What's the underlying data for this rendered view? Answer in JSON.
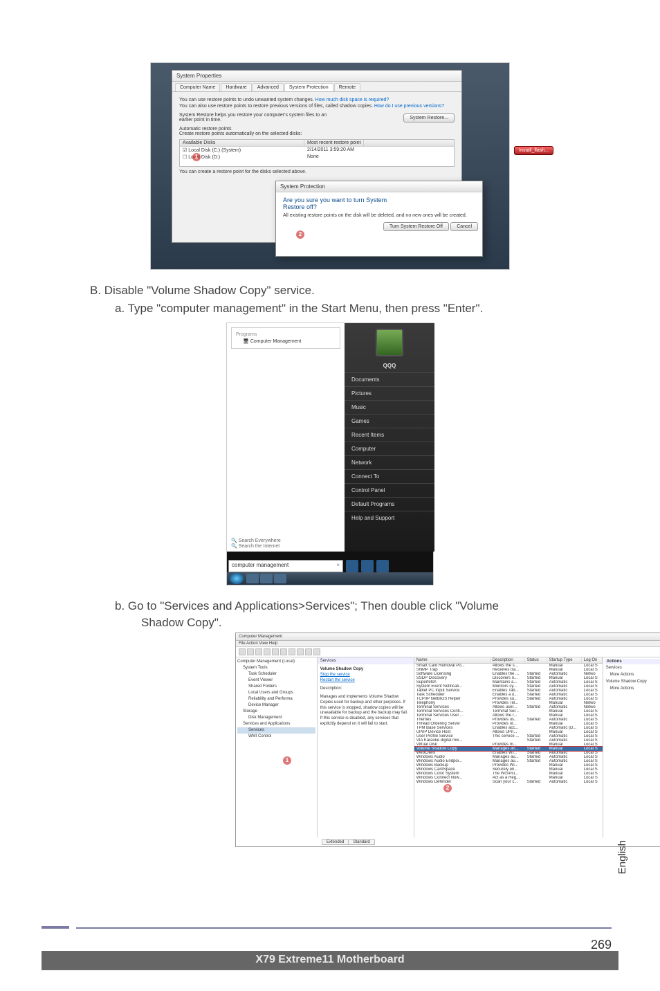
{
  "fig1": {
    "window_title": "System Properties",
    "tabs": [
      "Computer Name",
      "Hardware",
      "Advanced",
      "System Protection",
      "Remote"
    ],
    "info1": "You can use restore points to undo unwanted system changes.",
    "info1_link": "How much disk space is required?",
    "info2": "You can also use restore points to restore previous versions of files, called shadow copies.",
    "info2_link": "How do I use previous versions?",
    "restore_help": "System Restore helps you restore your computer's system files to an earlier point in time.",
    "restore_btn": "System Restore...",
    "auto_heading": "Automatic restore points",
    "auto_text": "Create restore points automatically on the selected disks:",
    "col_disk": "Available Disks",
    "col_recent": "Most recent restore point",
    "row1_disk": "Local Disk (C:) (System)",
    "row1_recent": "2/14/2011 3:59:20 AM",
    "row2_disk": "Local Disk (D:)",
    "row2_recent": "None",
    "install_btn": "Install_flash...",
    "create_text": "You can create a restore point for the disks selected above.",
    "confirm_title": "System Protection",
    "confirm_q1": "Are you sure you want to turn System",
    "confirm_q2": "Restore off?",
    "confirm_body": "All existing restore points on the disk will be deleted, and no new ones will be created.",
    "confirm_ok": "Turn System Restore Off",
    "confirm_cancel": "Cancel",
    "mark1": "1",
    "mark2": "2"
  },
  "stepB": "B. Disable \"Volume Shadow Copy\" service.",
  "stepBa": "a. Type \"computer management\" in the Start Menu, then press \"Enter\".",
  "fig2": {
    "programs_label": "Programs",
    "program_item": "Computer Management",
    "search_everywhere": "Search Everywhere",
    "search_internet": "Search the Internet",
    "search_value": "computer management",
    "user": "QQQ",
    "right_items": [
      "Documents",
      "Pictures",
      "Music",
      "Games",
      "Recent Items",
      "Computer",
      "Network",
      "Connect To",
      "Control Panel",
      "Default Programs",
      "Help and Support"
    ]
  },
  "stepBb_pre": "b. Go to \"Services and Applications>Services\"; Then double click \"Volume",
  "stepBb_post": "Shadow Copy\".",
  "fig3": {
    "title": "Computer Management",
    "menu": "File   Action   View   Help",
    "root": "Computer Management (Local)",
    "tree": [
      "System Tools",
      "Task Scheduler",
      "Event Viewer",
      "Shared Folders",
      "Local Users and Groups",
      "Reliability and Performa",
      "Device Manager",
      "Storage",
      "Disk Management",
      "Services and Applications",
      "Services",
      "WMI Control"
    ],
    "panel_header": "Services",
    "svc_name": "Volume Shadow Copy",
    "svc_stop": "Stop the service",
    "svc_restart": "Restart the service",
    "svc_desc_label": "Description:",
    "svc_desc": "Manages and implements Volume Shadow Copies used for backup and other purposes. If this service is stopped, shadow copies will be unavailable for backup and the backup may fail. If this service is disabled, any services that explicitly depend on it will fail to start.",
    "cols": [
      "Name",
      "Description",
      "Status",
      "Startup Type",
      "Log On"
    ],
    "rows": [
      {
        "n": "Smart Card Removal Po...",
        "d": "Allows the s...",
        "s": "",
        "t": "Manual",
        "l": "Local S"
      },
      {
        "n": "SNMP Trap",
        "d": "Receives tra...",
        "s": "",
        "t": "Manual",
        "l": "Local S"
      },
      {
        "n": "Software Licensing",
        "d": "Enables the ...",
        "s": "Started",
        "t": "Automatic",
        "l": "Netwo"
      },
      {
        "n": "SSDP Discovery",
        "d": "Discovers n...",
        "s": "Started",
        "t": "Manual",
        "l": "Local S"
      },
      {
        "n": "Superfetch",
        "d": "Maintains a...",
        "s": "Started",
        "t": "Automatic",
        "l": "Local S"
      },
      {
        "n": "System Event Notificati...",
        "d": "Monitors sy...",
        "s": "Started",
        "t": "Automatic",
        "l": "Local S"
      },
      {
        "n": "Tablet PC Input Service",
        "d": "Enables Tab...",
        "s": "Started",
        "t": "Automatic",
        "l": "Local S"
      },
      {
        "n": "Task Scheduler",
        "d": "Enables a u...",
        "s": "Started",
        "t": "Automatic",
        "l": "Local S"
      },
      {
        "n": "TCP/IP NetBIOS Helper",
        "d": "Provides su...",
        "s": "Started",
        "t": "Automatic",
        "l": "Local S"
      },
      {
        "n": "Telephony",
        "d": "Provides Tel...",
        "s": "",
        "t": "Manual",
        "l": "Netwo"
      },
      {
        "n": "Terminal Services",
        "d": "Allows user...",
        "s": "Started",
        "t": "Automatic",
        "l": "Netwo"
      },
      {
        "n": "Terminal Services Confi...",
        "d": "Terminal Ser...",
        "s": "",
        "t": "Manual",
        "l": "Local S"
      },
      {
        "n": "Terminal Services User ...",
        "d": "Allows the r...",
        "s": "",
        "t": "Manual",
        "l": "Local S"
      },
      {
        "n": "Themes",
        "d": "Provides us...",
        "s": "Started",
        "t": "Automatic",
        "l": "Local S"
      },
      {
        "n": "Thread Ordering Server",
        "d": "Provides or...",
        "s": "",
        "t": "Manual",
        "l": "Local S"
      },
      {
        "n": "TPM Base Services",
        "d": "Enables acc...",
        "s": "",
        "t": "Automatic (D...",
        "l": "Local S"
      },
      {
        "n": "UPnP Device Host",
        "d": "Allows UPn...",
        "s": "",
        "t": "Manual",
        "l": "Local S"
      },
      {
        "n": "User Profile Service",
        "d": "This service ...",
        "s": "Started",
        "t": "Automatic",
        "l": "Local S"
      },
      {
        "n": "VIA Karaoke digital mix...",
        "d": "",
        "s": "Started",
        "t": "Automatic",
        "l": "Local S"
      },
      {
        "n": "Virtual Disk",
        "d": "Provides m...",
        "s": "",
        "t": "Manual",
        "l": "Local S"
      },
      {
        "n": "Volume Shadow Copy",
        "d": "Manages an...",
        "s": "Started",
        "t": "Manual",
        "l": "Local S",
        "hl": true
      },
      {
        "n": "WebClient",
        "d": "Enables Wi...",
        "s": "Started",
        "t": "Automatic",
        "l": "Local S"
      },
      {
        "n": "Windows Audio",
        "d": "Manages au...",
        "s": "Started",
        "t": "Automatic",
        "l": "Local S"
      },
      {
        "n": "Windows Audio Endpoi...",
        "d": "Manages au...",
        "s": "Started",
        "t": "Automatic",
        "l": "Local S"
      },
      {
        "n": "Windows Backup",
        "d": "Provides Wi...",
        "s": "",
        "t": "Manual",
        "l": "Local S"
      },
      {
        "n": "Windows CardSpace",
        "d": "Securely en...",
        "s": "",
        "t": "Manual",
        "l": "Local S"
      },
      {
        "n": "Windows Color System",
        "d": "The WcsPlu...",
        "s": "",
        "t": "Manual",
        "l": "Local S"
      },
      {
        "n": "Windows Connect Now...",
        "d": "Act as a Reg...",
        "s": "",
        "t": "Manual",
        "l": "Local S"
      },
      {
        "n": "Windows Defender",
        "d": "Scan your c...",
        "s": "Started",
        "t": "Automatic",
        "l": "Local S"
      }
    ],
    "actions_header": "Actions",
    "actions_svc": "Services",
    "actions_more1": "More Actions",
    "actions_vsc": "Volume Shadow Copy",
    "actions_more2": "More Actions",
    "tab_ext": "Extended",
    "tab_std": "Standard",
    "mark1": "1",
    "mark2": "2"
  },
  "side_label": "English",
  "page_number": "269",
  "footer": "X79  Extreme11  Motherboard"
}
